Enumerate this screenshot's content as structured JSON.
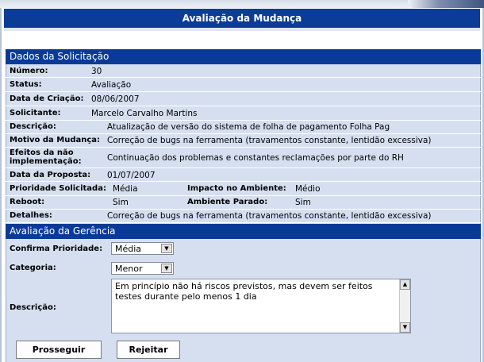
{
  "header": {
    "title": "Avaliação da Mudança"
  },
  "solicitacao": {
    "section_title": "Dados da Solicitação",
    "numero_label": "Número:",
    "numero": "30",
    "status_label": "Status:",
    "status": "Avaliação",
    "data_criacao_label": "Data de Criação:",
    "data_criacao": "08/06/2007",
    "solicitante_label": "Solicitante:",
    "solicitante": "Marcelo Carvalho Martins",
    "descricao_label": "Descrição:",
    "descricao": "Atualização de versão do sistema de folha de pagamento Folha Pag",
    "motivo_label": "Motivo da Mudança:",
    "motivo": "Correção de bugs na ferramenta (travamentos constante, lentidão excessiva)",
    "efeitos_label_1": "Efeitos da não",
    "efeitos_label_2": "implementação:",
    "efeitos": "Continuação dos problemas e constantes reclamações por parte do RH",
    "data_proposta_label": "Data da Proposta:",
    "data_proposta": "01/07/2007",
    "prioridade_label": "Prioridade Solicitada:",
    "prioridade": "Média",
    "impacto_label": "Impacto no Ambiente:",
    "impacto": "Médio",
    "reboot_label": "Reboot:",
    "reboot": "Sim",
    "ambiente_parado_label": "Ambiente Parado:",
    "ambiente_parado": "Sim",
    "detalhes_label": "Detalhes:",
    "detalhes": "Correção de bugs na ferramenta (travamentos constante, lentidão excessiva)"
  },
  "gerencia": {
    "section_title": "Avaliação da Gerência",
    "confirma_prioridade_label": "Confirma Prioridade:",
    "confirma_prioridade_value": "Média",
    "categoria_label": "Categoria:",
    "categoria_value": "Menor",
    "descricao_label": "Descrição:",
    "descricao_value": "Em princípio não há riscos previstos, mas devem ser feitos testes durante pelo menos 1 dia"
  },
  "buttons": {
    "prosseguir": "Prosseguir",
    "rejeitar": "Rejeitar"
  },
  "colors": {
    "header_blue": "#0b3c97",
    "panel": "#d5dff0"
  }
}
